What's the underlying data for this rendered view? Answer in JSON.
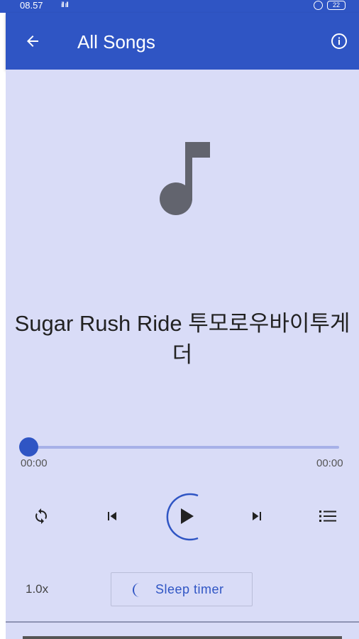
{
  "status_bar": {
    "time": "08.57",
    "signal": "ill ıll",
    "battery": "22"
  },
  "app_bar": {
    "back_icon": "arrow-left-icon",
    "title": "All Songs",
    "info_icon": "info-circle-icon"
  },
  "player": {
    "artwork_icon": "music-note-icon",
    "song_title": "Sugar Rush Ride 투모로우바이투게더",
    "position": "00:00",
    "duration": "00:00",
    "progress_fraction": 0,
    "controls": {
      "repeat_icon": "repeat-icon",
      "previous_icon": "skip-previous-icon",
      "play_icon": "play-icon",
      "next_icon": "skip-next-icon",
      "queue_icon": "queue-list-icon"
    },
    "speed": "1.0x",
    "sleep_timer_label": "Sleep timer",
    "sleep_icon": "moon-icon"
  },
  "colors": {
    "primary": "#2f55c4",
    "background": "#d9dcf7",
    "icon_dark": "#222222",
    "artwork": "#62646e"
  }
}
